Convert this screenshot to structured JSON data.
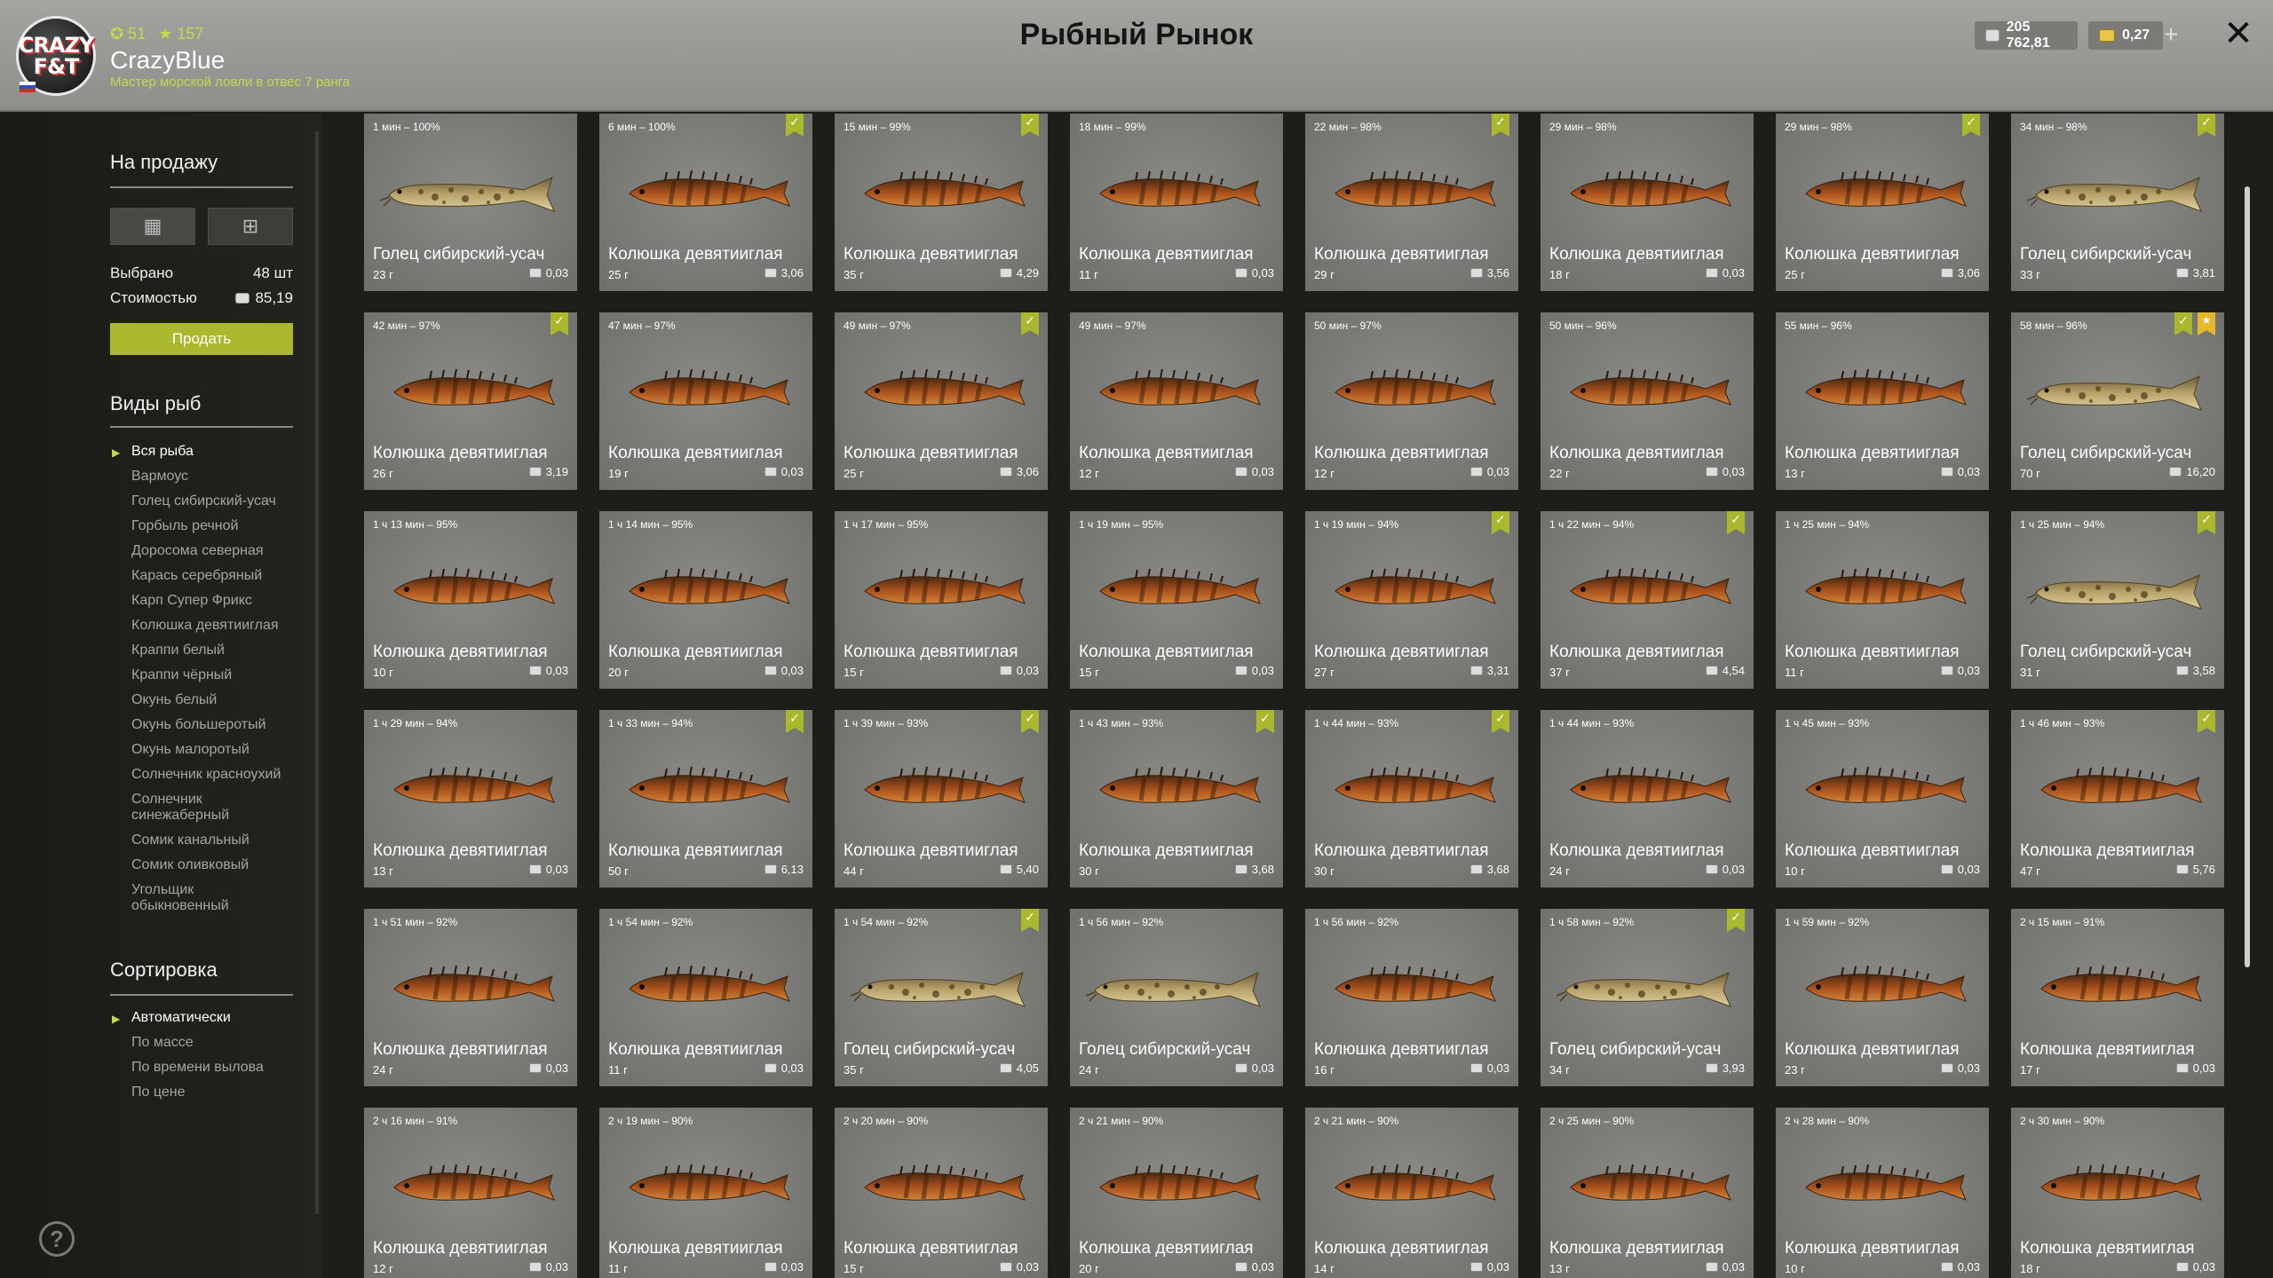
{
  "header": {
    "title": "Рыбный Рынок",
    "logo_text": "CRAZY F&T",
    "username": "CrazyBlue",
    "level": "51",
    "rating": "157",
    "rank": "Мастер морской ловли в отвес 7 ранга",
    "silver": "205 762,81",
    "gold": "0,27",
    "plus": "+",
    "close": "✕"
  },
  "sidebar": {
    "for_sale_title": "На продажу",
    "selected_label": "Выбрано",
    "selected_value": "48 шт",
    "cost_label": "Стоимостью",
    "cost_value": "85,19",
    "sell_button": "Продать",
    "species_title": "Виды рыб",
    "species": [
      "Вся рыба",
      "Вармоус",
      "Голец сибирский-усач",
      "Горбыль речной",
      "Доросома северная",
      "Карась серебряный",
      "Карп Супер Фрикс",
      "Колюшка девятииглая",
      "Краппи белый",
      "Краппи чёрный",
      "Окунь белый",
      "Окунь большеротый",
      "Окунь малоротый",
      "Солнечник красноухий",
      "Солнечник синежаберный",
      "Сомик канальный",
      "Сомик оливковый",
      "Угольщик обыкновенный"
    ],
    "sort_title": "Сортировка",
    "sort_options": [
      "Автоматически",
      "По массе",
      "По времени вылова",
      "По цене"
    ],
    "help": "?"
  },
  "cards": [
    {
      "time": "1 мин – 100%",
      "name": "Голец сибирский-усач",
      "weight": "23 г",
      "price": "0,03",
      "check": false,
      "star": false,
      "fish": "loach"
    },
    {
      "time": "6 мин – 100%",
      "name": "Колюшка девятииглая",
      "weight": "25 г",
      "price": "3,06",
      "check": true,
      "star": false,
      "fish": "stickleback"
    },
    {
      "time": "15 мин – 99%",
      "name": "Колюшка девятииглая",
      "weight": "35 г",
      "price": "4,29",
      "check": true,
      "star": false,
      "fish": "stickleback"
    },
    {
      "time": "18 мин – 99%",
      "name": "Колюшка девятииглая",
      "weight": "11 г",
      "price": "0,03",
      "check": false,
      "star": false,
      "fish": "stickleback"
    },
    {
      "time": "22 мин – 98%",
      "name": "Колюшка девятииглая",
      "weight": "29 г",
      "price": "3,56",
      "check": true,
      "star": false,
      "fish": "stickleback"
    },
    {
      "time": "29 мин – 98%",
      "name": "Колюшка девятииглая",
      "weight": "18 г",
      "price": "0,03",
      "check": false,
      "star": false,
      "fish": "stickleback"
    },
    {
      "time": "29 мин – 98%",
      "name": "Колюшка девятииглая",
      "weight": "25 г",
      "price": "3,06",
      "check": true,
      "star": false,
      "fish": "stickleback"
    },
    {
      "time": "34 мин – 98%",
      "name": "Голец сибирский-усач",
      "weight": "33 г",
      "price": "3,81",
      "check": true,
      "star": false,
      "fish": "loach"
    },
    {
      "time": "42 мин – 97%",
      "name": "Колюшка девятииглая",
      "weight": "26 г",
      "price": "3,19",
      "check": true,
      "star": false,
      "fish": "stickleback"
    },
    {
      "time": "47 мин – 97%",
      "name": "Колюшка девятииглая",
      "weight": "19 г",
      "price": "0,03",
      "check": false,
      "star": false,
      "fish": "stickleback"
    },
    {
      "time": "49 мин – 97%",
      "name": "Колюшка девятииглая",
      "weight": "25 г",
      "price": "3,06",
      "check": true,
      "star": false,
      "fish": "stickleback"
    },
    {
      "time": "49 мин – 97%",
      "name": "Колюшка девятииглая",
      "weight": "12 г",
      "price": "0,03",
      "check": false,
      "star": false,
      "fish": "stickleback"
    },
    {
      "time": "50 мин – 97%",
      "name": "Колюшка девятииглая",
      "weight": "12 г",
      "price": "0,03",
      "check": false,
      "star": false,
      "fish": "stickleback"
    },
    {
      "time": "50 мин – 96%",
      "name": "Колюшка девятииглая",
      "weight": "22 г",
      "price": "0,03",
      "check": false,
      "star": false,
      "fish": "stickleback"
    },
    {
      "time": "55 мин – 96%",
      "name": "Колюшка девятииглая",
      "weight": "13 г",
      "price": "0,03",
      "check": false,
      "star": false,
      "fish": "stickleback"
    },
    {
      "time": "58 мин – 96%",
      "name": "Голец сибирский-усач",
      "weight": "70 г",
      "price": "16,20",
      "check": true,
      "star": true,
      "fish": "loach"
    },
    {
      "time": "1 ч 13 мин – 95%",
      "name": "Колюшка девятииглая",
      "weight": "10 г",
      "price": "0,03",
      "check": false,
      "star": false,
      "fish": "stickleback"
    },
    {
      "time": "1 ч 14 мин – 95%",
      "name": "Колюшка девятииглая",
      "weight": "20 г",
      "price": "0,03",
      "check": false,
      "star": false,
      "fish": "stickleback"
    },
    {
      "time": "1 ч 17 мин – 95%",
      "name": "Колюшка девятииглая",
      "weight": "15 г",
      "price": "0,03",
      "check": false,
      "star": false,
      "fish": "stickleback"
    },
    {
      "time": "1 ч 19 мин – 95%",
      "name": "Колюшка девятииглая",
      "weight": "15 г",
      "price": "0,03",
      "check": false,
      "star": false,
      "fish": "stickleback"
    },
    {
      "time": "1 ч 19 мин – 94%",
      "name": "Колюшка девятииглая",
      "weight": "27 г",
      "price": "3,31",
      "check": true,
      "star": false,
      "fish": "stickleback"
    },
    {
      "time": "1 ч 22 мин – 94%",
      "name": "Колюшка девятииглая",
      "weight": "37 г",
      "price": "4,54",
      "check": true,
      "star": false,
      "fish": "stickleback"
    },
    {
      "time": "1 ч 25 мин – 94%",
      "name": "Колюшка девятииглая",
      "weight": "11 г",
      "price": "0,03",
      "check": false,
      "star": false,
      "fish": "stickleback"
    },
    {
      "time": "1 ч 25 мин – 94%",
      "name": "Голец сибирский-усач",
      "weight": "31 г",
      "price": "3,58",
      "check": true,
      "star": false,
      "fish": "loach"
    },
    {
      "time": "1 ч 29 мин – 94%",
      "name": "Колюшка девятииглая",
      "weight": "13 г",
      "price": "0,03",
      "check": false,
      "star": false,
      "fish": "stickleback"
    },
    {
      "time": "1 ч 33 мин – 94%",
      "name": "Колюшка девятииглая",
      "weight": "50 г",
      "price": "6,13",
      "check": true,
      "star": false,
      "fish": "stickleback"
    },
    {
      "time": "1 ч 39 мин – 93%",
      "name": "Колюшка девятииглая",
      "weight": "44 г",
      "price": "5,40",
      "check": true,
      "star": false,
      "fish": "stickleback"
    },
    {
      "time": "1 ч 43 мин – 93%",
      "name": "Колюшка девятииглая",
      "weight": "30 г",
      "price": "3,68",
      "check": true,
      "star": false,
      "fish": "stickleback"
    },
    {
      "time": "1 ч 44 мин – 93%",
      "name": "Колюшка девятииглая",
      "weight": "30 г",
      "price": "3,68",
      "check": true,
      "star": false,
      "fish": "stickleback"
    },
    {
      "time": "1 ч 44 мин – 93%",
      "name": "Колюшка девятииглая",
      "weight": "24 г",
      "price": "0,03",
      "check": false,
      "star": false,
      "fish": "stickleback"
    },
    {
      "time": "1 ч 45 мин – 93%",
      "name": "Колюшка девятииглая",
      "weight": "10 г",
      "price": "0,03",
      "check": false,
      "star": false,
      "fish": "stickleback"
    },
    {
      "time": "1 ч 46 мин – 93%",
      "name": "Колюшка девятииглая",
      "weight": "47 г",
      "price": "5,76",
      "check": true,
      "star": false,
      "fish": "stickleback"
    },
    {
      "time": "1 ч 51 мин – 92%",
      "name": "Колюшка девятииглая",
      "weight": "24 г",
      "price": "0,03",
      "check": false,
      "star": false,
      "fish": "stickleback"
    },
    {
      "time": "1 ч 54 мин – 92%",
      "name": "Колюшка девятииглая",
      "weight": "11 г",
      "price": "0,03",
      "check": false,
      "star": false,
      "fish": "stickleback"
    },
    {
      "time": "1 ч 54 мин – 92%",
      "name": "Голец сибирский-усач",
      "weight": "35 г",
      "price": "4,05",
      "check": true,
      "star": false,
      "fish": "loach"
    },
    {
      "time": "1 ч 56 мин – 92%",
      "name": "Голец сибирский-усач",
      "weight": "24 г",
      "price": "0,03",
      "check": false,
      "star": false,
      "fish": "loach"
    },
    {
      "time": "1 ч 56 мин – 92%",
      "name": "Колюшка девятииглая",
      "weight": "16 г",
      "price": "0,03",
      "check": false,
      "star": false,
      "fish": "stickleback"
    },
    {
      "time": "1 ч 58 мин – 92%",
      "name": "Голец сибирский-усач",
      "weight": "34 г",
      "price": "3,93",
      "check": true,
      "star": false,
      "fish": "loach"
    },
    {
      "time": "1 ч 59 мин – 92%",
      "name": "Колюшка девятииглая",
      "weight": "23 г",
      "price": "0,03",
      "check": false,
      "star": false,
      "fish": "stickleback"
    },
    {
      "time": "2 ч 15 мин – 91%",
      "name": "Колюшка девятииглая",
      "weight": "17 г",
      "price": "0,03",
      "check": false,
      "star": false,
      "fish": "stickleback"
    },
    {
      "time": "2 ч 16 мин – 91%",
      "name": "Колюшка девятииглая",
      "weight": "12 г",
      "price": "0,03",
      "check": false,
      "star": false,
      "fish": "stickleback"
    },
    {
      "time": "2 ч 19 мин – 90%",
      "name": "Колюшка девятииглая",
      "weight": "11 г",
      "price": "0,03",
      "check": false,
      "star": false,
      "fish": "stickleback"
    },
    {
      "time": "2 ч 20 мин – 90%",
      "name": "Колюшка девятииглая",
      "weight": "15 г",
      "price": "0,03",
      "check": false,
      "star": false,
      "fish": "stickleback"
    },
    {
      "time": "2 ч 21 мин – 90%",
      "name": "Колюшка девятииглая",
      "weight": "20 г",
      "price": "0,03",
      "check": false,
      "star": false,
      "fish": "stickleback"
    },
    {
      "time": "2 ч 21 мин – 90%",
      "name": "Колюшка девятииглая",
      "weight": "14 г",
      "price": "0,03",
      "check": false,
      "star": false,
      "fish": "stickleback"
    },
    {
      "time": "2 ч 25 мин – 90%",
      "name": "Колюшка девятииглая",
      "weight": "13 г",
      "price": "0,03",
      "check": false,
      "star": false,
      "fish": "stickleback"
    },
    {
      "time": "2 ч 28 мин – 90%",
      "name": "Колюшка девятииглая",
      "weight": "10 г",
      "price": "0,03",
      "check": false,
      "star": false,
      "fish": "stickleback"
    },
    {
      "time": "2 ч 30 мин – 90%",
      "name": "Колюшка девятииглая",
      "weight": "18 г",
      "price": "0,03",
      "check": false,
      "star": false,
      "fish": "stickleback"
    }
  ]
}
